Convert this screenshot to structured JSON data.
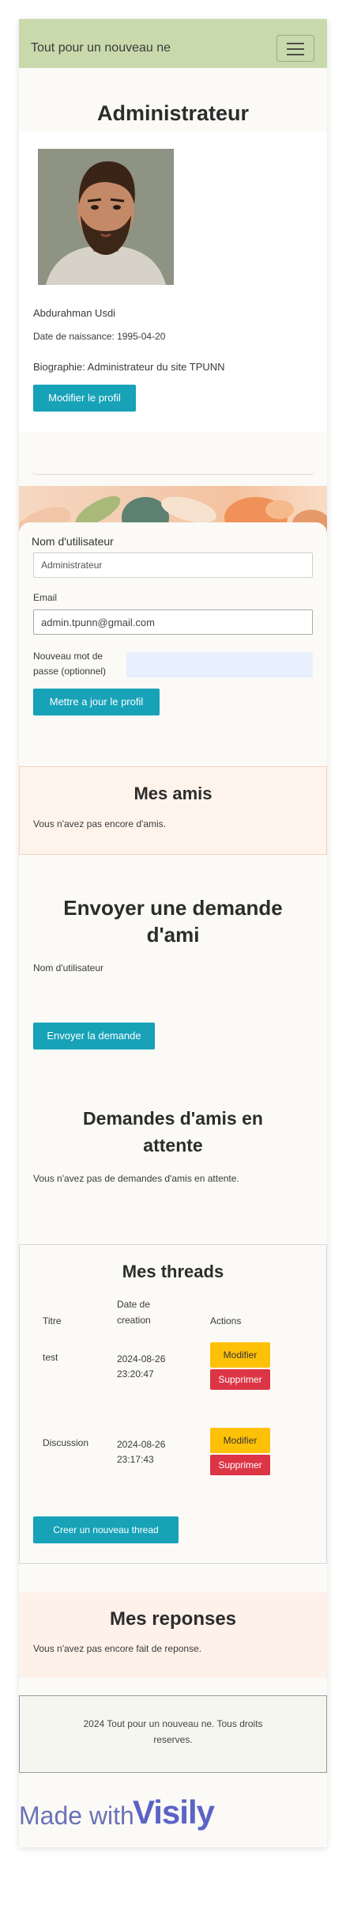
{
  "navbar": {
    "brand": "Tout pour un nouveau ne"
  },
  "profile": {
    "title": "Administrateur",
    "name": "Abdurahman Usdi",
    "birth": "Date de naissance: 1995-04-20",
    "bio": "Biographie: Administrateur du site TPUNN",
    "edit_label": "Modifier le profil"
  },
  "edit_form": {
    "username_label": "Nom d'utilisateur",
    "username_value": "Administrateur",
    "email_label": "Email",
    "email_value": "admin.tpunn@gmail.com",
    "password_label_1": "Nouveau mot de",
    "password_label_2": "passe (optionnel)",
    "submit_label": "Mettre a jour le profil"
  },
  "friends": {
    "title": "Mes amis",
    "empty": "Vous n'avez pas encore d'amis."
  },
  "send_request": {
    "title_1": "Envoyer une demande",
    "title_2": "d'ami",
    "username_label": "Nom d'utilisateur",
    "submit_label": "Envoyer la demande"
  },
  "pending": {
    "title_1": "Demandes d'amis en",
    "title_2": "attente",
    "empty": "Vous n'avez pas de demandes d'amis en attente."
  },
  "threads": {
    "title": "Mes threads",
    "col_title": "Titre",
    "col_date_1": "Date de",
    "col_date_2": "creation",
    "col_actions": "Actions",
    "rows": [
      {
        "title": "test",
        "date": "2024-08-26",
        "time": "23:20:47",
        "edit": "Modifier",
        "delete": "Supprimer"
      },
      {
        "title": "Discussion",
        "date": "2024-08-26",
        "time": "23:17:43",
        "edit": "Modifier",
        "delete": "Supprimer"
      }
    ],
    "new_label": "Creer un nouveau thread"
  },
  "replies": {
    "title": "Mes reponses",
    "empty": "Vous n'avez pas encore fait de reponse."
  },
  "footer": {
    "line1": "2024 Tout pour un nouveau ne. Tous droits",
    "line2": "reserves."
  },
  "watermark": {
    "made_with": "Made with",
    "brand": "Visily"
  },
  "colors": {
    "navbar": "#c8d9ac",
    "accent": "#17a2b8",
    "edit": "#ffc107",
    "delete": "#dc3545"
  }
}
